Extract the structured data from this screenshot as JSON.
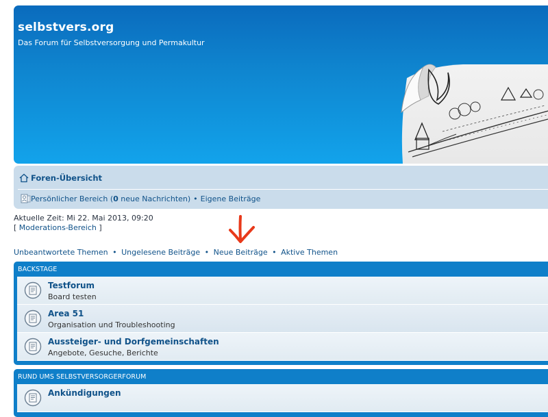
{
  "header": {
    "site_title": "selbstvers.org",
    "site_description": "Das Forum für Selbstversorgung und Permakultur"
  },
  "navbar": {
    "home_label": "Foren-Übersicht",
    "personal_prefix": "Persönlicher Bereich (",
    "new_messages_count": "0",
    "personal_suffix": " neue Nachrichten)",
    "own_posts_label": "Eigene Beiträge"
  },
  "info": {
    "current_time": "Aktuelle Zeit: Mi 22. Mai 2013, 09:20",
    "mod_area_open": "[ ",
    "mod_area_label": "Moderations-Bereich",
    "mod_area_close": " ]"
  },
  "quick_links": {
    "unanswered": "Unbeantwortete Themen",
    "unread": "Ungelesene Beiträge",
    "new_posts": "Neue Beiträge",
    "active": "Aktive Themen",
    "separator": "•"
  },
  "categories": [
    {
      "title": "BACKSTAGE",
      "forums": [
        {
          "title": "Testforum",
          "description": "Board testen"
        },
        {
          "title": "Area 51",
          "description": "Organisation und Troubleshooting"
        },
        {
          "title": "Aussteiger- und Dorfgemeinschaften",
          "description": "Angebote, Gesuche, Berichte"
        }
      ]
    },
    {
      "title": "RUND UMS SELBSTVERSORGERFORUM",
      "forums": [
        {
          "title": "Ankündigungen",
          "description": ""
        }
      ]
    }
  ],
  "colors": {
    "header_top": "#0a6bbd",
    "header_bottom": "#12a3eb",
    "navbar_bg": "#cadceb",
    "link": "#105289",
    "category_bar": "#0f7fc9",
    "annotation_arrow": "#e8391a"
  },
  "icons": {
    "home": "home-icon",
    "personal": "user-card-icon",
    "forum": "forum-read-icon",
    "annotation": "red-down-arrow"
  }
}
